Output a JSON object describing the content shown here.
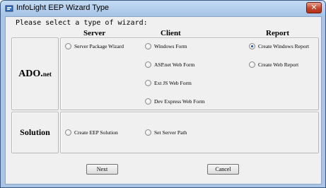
{
  "window": {
    "title": "InfoLight EEP Wizard Type",
    "close_label": "✕"
  },
  "prompt": "Please select a type of wizard:",
  "columns": {
    "server": "Server",
    "client": "Client",
    "report": "Report"
  },
  "rows": {
    "ado": {
      "label_main": "ADO.",
      "label_sub": "net",
      "options": {
        "server_package_wizard": {
          "label": "Server Package Wizard",
          "checked": false
        },
        "windows_form": {
          "label": "Windows Form",
          "checked": false
        },
        "aspnet_web_form": {
          "label": "ASP.net Web Form",
          "checked": false
        },
        "extjs_web_form": {
          "label": "Ext JS Web Form",
          "checked": false
        },
        "devexpress_web_form": {
          "label": "Dev Express Web Form",
          "checked": false
        },
        "create_windows_report": {
          "label": "Create Windows Report",
          "checked": true
        },
        "create_web_report": {
          "label": "Create Web Report",
          "checked": false
        }
      }
    },
    "solution": {
      "label": "Solution",
      "options": {
        "create_eep_solution": {
          "label": "Create EEP Solution",
          "checked": false
        },
        "set_server_path": {
          "label": "Set Server Path",
          "checked": false
        }
      }
    }
  },
  "buttons": {
    "next": "Next",
    "cancel": "Cancel"
  },
  "colors": {
    "title_bar": "#a9c4e4",
    "client_bg": "#f0f0f0",
    "close_button": "#c4432a",
    "radio_selected": "#1f4fa0"
  }
}
